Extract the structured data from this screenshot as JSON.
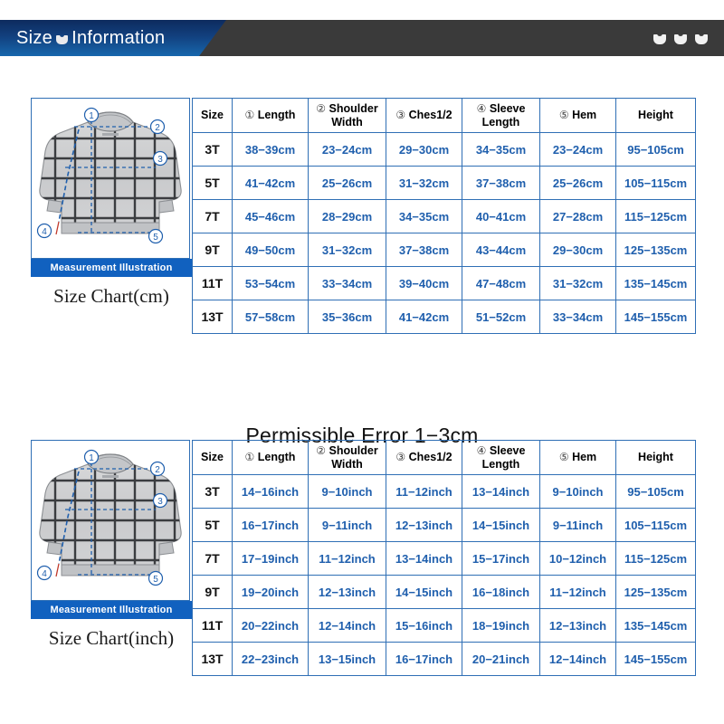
{
  "header": {
    "title_first": "Size",
    "title_second": "Information",
    "icon": "shirt-icon",
    "decor_icons": [
      "shirt-icon",
      "shirt-icon",
      "shirt-icon"
    ],
    "blue": "#12407e",
    "dark": "#3a3a3a"
  },
  "colors": {
    "table_border": "#2f6fb5",
    "data_text": "#1f5fad",
    "caption_bar": "#1161bf",
    "header_text": "#000000"
  },
  "illustration": {
    "caption_bar": "Measurement Illustration",
    "markers": [
      "①",
      "②",
      "③",
      "④",
      "⑤"
    ],
    "alt": "grey windowpane plaid crewneck sweater with dashed measurement lines"
  },
  "permissible_error": "Permissible Error 1−3cm",
  "columns": [
    {
      "num": "",
      "label": "Size"
    },
    {
      "num": "①",
      "label": "Length"
    },
    {
      "num": "②",
      "label": "Shoulder Width"
    },
    {
      "num": "③",
      "label": "Ches1/2"
    },
    {
      "num": "④",
      "label": "Sleeve Length"
    },
    {
      "num": "⑤",
      "label": "Hem"
    },
    {
      "num": "",
      "label": "Height"
    }
  ],
  "section_cm": {
    "chart_title": "Size Chart(cm)",
    "rows": [
      {
        "size": "3T",
        "length": "38−39cm",
        "shoulder": "23−24cm",
        "chest": "29−30cm",
        "sleeve": "34−35cm",
        "hem": "23−24cm",
        "height": "95−105cm"
      },
      {
        "size": "5T",
        "length": "41−42cm",
        "shoulder": "25−26cm",
        "chest": "31−32cm",
        "sleeve": "37−38cm",
        "hem": "25−26cm",
        "height": "105−115cm"
      },
      {
        "size": "7T",
        "length": "45−46cm",
        "shoulder": "28−29cm",
        "chest": "34−35cm",
        "sleeve": "40−41cm",
        "hem": "27−28cm",
        "height": "115−125cm"
      },
      {
        "size": "9T",
        "length": "49−50cm",
        "shoulder": "31−32cm",
        "chest": "37−38cm",
        "sleeve": "43−44cm",
        "hem": "29−30cm",
        "height": "125−135cm"
      },
      {
        "size": "11T",
        "length": "53−54cm",
        "shoulder": "33−34cm",
        "chest": "39−40cm",
        "sleeve": "47−48cm",
        "hem": "31−32cm",
        "height": "135−145cm"
      },
      {
        "size": "13T",
        "length": "57−58cm",
        "shoulder": "35−36cm",
        "chest": "41−42cm",
        "sleeve": "51−52cm",
        "hem": "33−34cm",
        "height": "145−155cm"
      }
    ]
  },
  "section_inch": {
    "chart_title": "Size Chart(inch)",
    "rows": [
      {
        "size": "3T",
        "length": "14−16inch",
        "shoulder": "9−10inch",
        "chest": "11−12inch",
        "sleeve": "13−14inch",
        "hem": "9−10inch",
        "height": "95−105cm"
      },
      {
        "size": "5T",
        "length": "16−17inch",
        "shoulder": "9−11inch",
        "chest": "12−13inch",
        "sleeve": "14−15inch",
        "hem": "9−11inch",
        "height": "105−115cm"
      },
      {
        "size": "7T",
        "length": "17−19inch",
        "shoulder": "11−12inch",
        "chest": "13−14inch",
        "sleeve": "15−17inch",
        "hem": "10−12inch",
        "height": "115−125cm"
      },
      {
        "size": "9T",
        "length": "19−20inch",
        "shoulder": "12−13inch",
        "chest": "14−15inch",
        "sleeve": "16−18inch",
        "hem": "11−12inch",
        "height": "125−135cm"
      },
      {
        "size": "11T",
        "length": "20−22inch",
        "shoulder": "12−14inch",
        "chest": "15−16inch",
        "sleeve": "18−19inch",
        "hem": "12−13inch",
        "height": "135−145cm"
      },
      {
        "size": "13T",
        "length": "22−23inch",
        "shoulder": "13−15inch",
        "chest": "16−17inch",
        "sleeve": "20−21inch",
        "hem": "12−14inch",
        "height": "145−155cm"
      }
    ]
  }
}
